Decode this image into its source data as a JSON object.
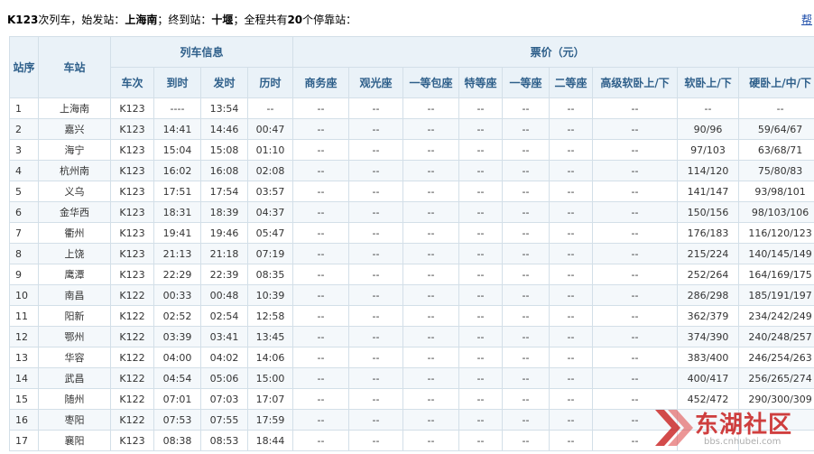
{
  "header": {
    "train_prefix": "K123",
    "train_suffix": "次列车，",
    "start_label": "始发站：",
    "start_station": "上海南",
    "end_label": "；终到站：",
    "end_station": "十堰",
    "stops_prefix": "；全程共有",
    "stops_count": "20",
    "stops_suffix": "个停靠站：",
    "help_link": "帮"
  },
  "columns": {
    "seq": "站序",
    "station": "车站",
    "train_info": "列车信息",
    "price_group": "票价（元）",
    "train_no": "车次",
    "arrive": "到时",
    "depart": "发时",
    "duration": "历时",
    "business": "商务座",
    "sightseeing": "观光座",
    "first_box": "一等包座",
    "premium": "特等座",
    "first_class": "一等座",
    "second_class": "二等座",
    "deluxe_soft_sleeper": "高级软卧上/下",
    "soft_sleeper": "软卧上/下",
    "hard_sleeper": "硬卧上/中/下"
  },
  "rows": [
    {
      "seq": "1",
      "station": "上海南",
      "train": "K123",
      "arrive": "----",
      "depart": "13:54",
      "duration": "--",
      "business": "--",
      "sightseeing": "--",
      "first_box": "--",
      "premium": "--",
      "first_class": "--",
      "second_class": "--",
      "deluxe": "--",
      "soft": "--",
      "hard": "--"
    },
    {
      "seq": "2",
      "station": "嘉兴",
      "train": "K123",
      "arrive": "14:41",
      "depart": "14:46",
      "duration": "00:47",
      "business": "--",
      "sightseeing": "--",
      "first_box": "--",
      "premium": "--",
      "first_class": "--",
      "second_class": "--",
      "deluxe": "--",
      "soft": "90/96",
      "hard": "59/64/67"
    },
    {
      "seq": "3",
      "station": "海宁",
      "train": "K123",
      "arrive": "15:04",
      "depart": "15:08",
      "duration": "01:10",
      "business": "--",
      "sightseeing": "--",
      "first_box": "--",
      "premium": "--",
      "first_class": "--",
      "second_class": "--",
      "deluxe": "--",
      "soft": "97/103",
      "hard": "63/68/71"
    },
    {
      "seq": "4",
      "station": "杭州南",
      "train": "K123",
      "arrive": "16:02",
      "depart": "16:08",
      "duration": "02:08",
      "business": "--",
      "sightseeing": "--",
      "first_box": "--",
      "premium": "--",
      "first_class": "--",
      "second_class": "--",
      "deluxe": "--",
      "soft": "114/120",
      "hard": "75/80/83"
    },
    {
      "seq": "5",
      "station": "义乌",
      "train": "K123",
      "arrive": "17:51",
      "depart": "17:54",
      "duration": "03:57",
      "business": "--",
      "sightseeing": "--",
      "first_box": "--",
      "premium": "--",
      "first_class": "--",
      "second_class": "--",
      "deluxe": "--",
      "soft": "141/147",
      "hard": "93/98/101"
    },
    {
      "seq": "6",
      "station": "金华西",
      "train": "K123",
      "arrive": "18:31",
      "depart": "18:39",
      "duration": "04:37",
      "business": "--",
      "sightseeing": "--",
      "first_box": "--",
      "premium": "--",
      "first_class": "--",
      "second_class": "--",
      "deluxe": "--",
      "soft": "150/156",
      "hard": "98/103/106"
    },
    {
      "seq": "7",
      "station": "衢州",
      "train": "K123",
      "arrive": "19:41",
      "depart": "19:46",
      "duration": "05:47",
      "business": "--",
      "sightseeing": "--",
      "first_box": "--",
      "premium": "--",
      "first_class": "--",
      "second_class": "--",
      "deluxe": "--",
      "soft": "176/183",
      "hard": "116/120/123"
    },
    {
      "seq": "8",
      "station": "上饶",
      "train": "K123",
      "arrive": "21:13",
      "depart": "21:18",
      "duration": "07:19",
      "business": "--",
      "sightseeing": "--",
      "first_box": "--",
      "premium": "--",
      "first_class": "--",
      "second_class": "--",
      "deluxe": "--",
      "soft": "215/224",
      "hard": "140/145/149"
    },
    {
      "seq": "9",
      "station": "鹰潭",
      "train": "K123",
      "arrive": "22:29",
      "depart": "22:39",
      "duration": "08:35",
      "business": "--",
      "sightseeing": "--",
      "first_box": "--",
      "premium": "--",
      "first_class": "--",
      "second_class": "--",
      "deluxe": "--",
      "soft": "252/264",
      "hard": "164/169/175"
    },
    {
      "seq": "10",
      "station": "南昌",
      "train": "K122",
      "arrive": "00:33",
      "depart": "00:48",
      "duration": "10:39",
      "business": "--",
      "sightseeing": "--",
      "first_box": "--",
      "premium": "--",
      "first_class": "--",
      "second_class": "--",
      "deluxe": "--",
      "soft": "286/298",
      "hard": "185/191/197"
    },
    {
      "seq": "11",
      "station": "阳新",
      "train": "K122",
      "arrive": "02:52",
      "depart": "02:54",
      "duration": "12:58",
      "business": "--",
      "sightseeing": "--",
      "first_box": "--",
      "premium": "--",
      "first_class": "--",
      "second_class": "--",
      "deluxe": "--",
      "soft": "362/379",
      "hard": "234/242/249"
    },
    {
      "seq": "12",
      "station": "鄂州",
      "train": "K122",
      "arrive": "03:39",
      "depart": "03:41",
      "duration": "13:45",
      "business": "--",
      "sightseeing": "--",
      "first_box": "--",
      "premium": "--",
      "first_class": "--",
      "second_class": "--",
      "deluxe": "--",
      "soft": "374/390",
      "hard": "240/248/257"
    },
    {
      "seq": "13",
      "station": "华容",
      "train": "K122",
      "arrive": "04:00",
      "depart": "04:02",
      "duration": "14:06",
      "business": "--",
      "sightseeing": "--",
      "first_box": "--",
      "premium": "--",
      "first_class": "--",
      "second_class": "--",
      "deluxe": "--",
      "soft": "383/400",
      "hard": "246/254/263"
    },
    {
      "seq": "14",
      "station": "武昌",
      "train": "K122",
      "arrive": "04:54",
      "depart": "05:06",
      "duration": "15:00",
      "business": "--",
      "sightseeing": "--",
      "first_box": "--",
      "premium": "--",
      "first_class": "--",
      "second_class": "--",
      "deluxe": "--",
      "soft": "400/417",
      "hard": "256/265/274"
    },
    {
      "seq": "15",
      "station": "随州",
      "train": "K122",
      "arrive": "07:01",
      "depart": "07:03",
      "duration": "17:07",
      "business": "--",
      "sightseeing": "--",
      "first_box": "--",
      "premium": "--",
      "first_class": "--",
      "second_class": "--",
      "deluxe": "--",
      "soft": "452/472",
      "hard": "290/300/309"
    },
    {
      "seq": "16",
      "station": "枣阳",
      "train": "K122",
      "arrive": "07:53",
      "depart": "07:55",
      "duration": "17:59",
      "business": "--",
      "sightseeing": "--",
      "first_box": "--",
      "premium": "--",
      "first_class": "--",
      "second_class": "--",
      "deluxe": "--",
      "soft": "",
      "hard": ""
    },
    {
      "seq": "17",
      "station": "襄阳",
      "train": "K123",
      "arrive": "08:38",
      "depart": "08:53",
      "duration": "18:44",
      "business": "--",
      "sightseeing": "--",
      "first_box": "--",
      "premium": "--",
      "first_class": "--",
      "second_class": "--",
      "deluxe": "--",
      "soft": "",
      "hard": ""
    }
  ],
  "watermark": {
    "brand": "东湖社区",
    "url": "bbs.cnhubei.com"
  }
}
